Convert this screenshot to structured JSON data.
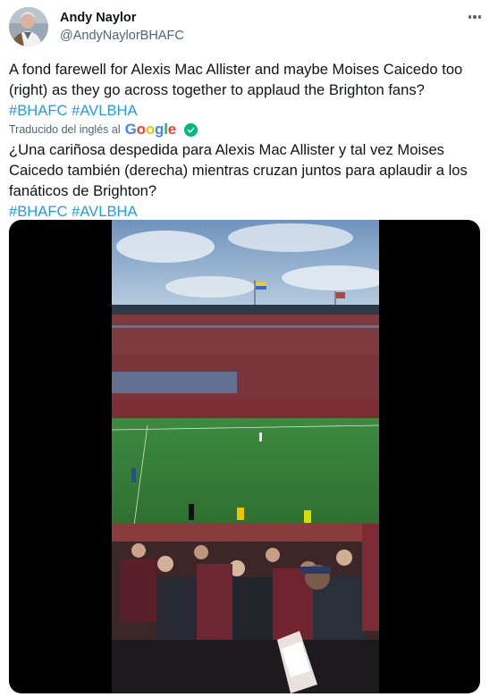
{
  "author": {
    "name": "Andy Naylor",
    "handle": "@AndyNaylorBHAFC"
  },
  "tweet": {
    "text": "A fond farewell for Alexis Mac Allister and maybe Moises Caicedo too (right) as they go across together to applaud the Brighton fans?",
    "hashtags": [
      "#BHAFC",
      "#AVLBHA"
    ]
  },
  "translation": {
    "label": "Traducido del inglés al",
    "provider": "Google",
    "text": "¿Una cariñosa despedida para Alexis Mac Allister y tal vez Moises Caicedo también (derecha) mientras cruzan juntos para aplaudir a los fanáticos de Brighton?",
    "hashtags": [
      "#BHAFC",
      "#AVLBHA"
    ]
  },
  "icons": {
    "more": "more-horizontal-icon",
    "verified_translation": "check-circle-icon"
  },
  "colors": {
    "text_primary": "#0f1419",
    "text_secondary": "#536471",
    "link": "#1d9bf0",
    "check": "#00ba7c",
    "google_blue": "#4285f4",
    "google_red": "#ea4335",
    "google_yellow": "#fbbc05",
    "google_green": "#34a853"
  }
}
